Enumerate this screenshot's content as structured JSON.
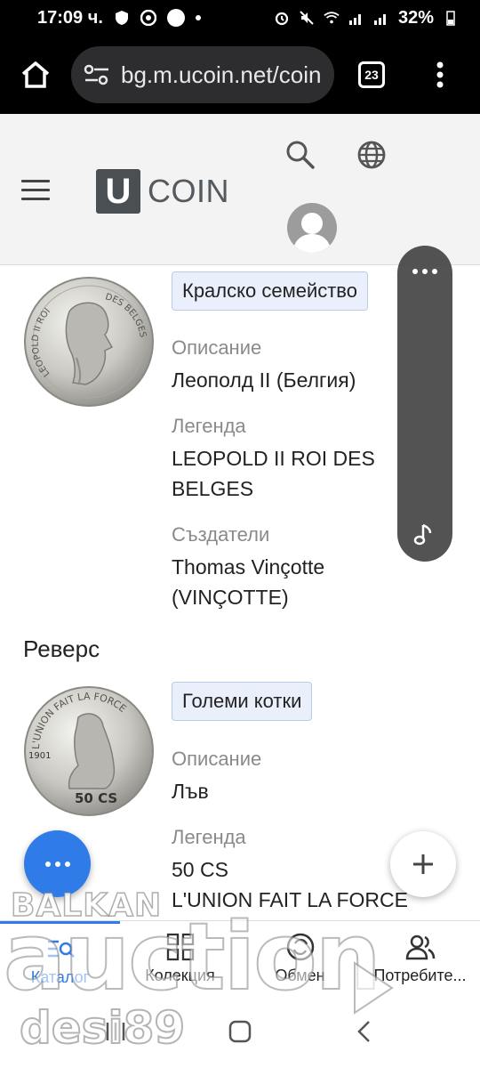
{
  "status_bar": {
    "time": "17:09 ч.",
    "battery": "32%"
  },
  "browser": {
    "url": "bg.m.ucoin.net/coin",
    "tab_count": "23"
  },
  "header": {
    "logo_letter": "U",
    "logo_text": "COIN"
  },
  "obverse": {
    "tag": "Кралско семейство",
    "description_label": "Описание",
    "description_value": "Леополд II (Белгия)",
    "legend_label": "Легенда",
    "legend_line1": "LEOPOLD II ROI DES",
    "legend_line2": "BELGES",
    "creators_label": "Създатели",
    "creators_line1": "Thomas Vinçotte",
    "creators_line2": "(VINÇOTTE)",
    "coin_legend_left": "LEOPOLD II ROI",
    "coin_legend_right": "DES BELGES"
  },
  "reverse": {
    "title": "Реверс",
    "tag": "Големи котки",
    "description_label": "Описание",
    "description_value": "Лъв",
    "legend_label": "Легенда",
    "legend_line1": "50 CS",
    "legend_line2": "L'UNION FAIT LA FORCE",
    "coin_legend_top": "L'UNION FAIT LA FORCE",
    "coin_year": "1901",
    "coin_value": "50 CS"
  },
  "bottom_nav": {
    "items": [
      {
        "label": "Каталог",
        "icon": "catalog-icon",
        "active": true
      },
      {
        "label": "Колекция",
        "icon": "collection-icon",
        "active": false
      },
      {
        "label": "Обмен",
        "icon": "exchange-icon",
        "active": false
      },
      {
        "label": "Потребите...",
        "icon": "users-icon",
        "active": false
      }
    ]
  },
  "watermark": {
    "brand": "BALKAN",
    "word": "auction",
    "user": "desi89"
  },
  "colors": {
    "accent": "#2f7be8",
    "tag_bg": "#eaf0fb",
    "header_bg": "#f3f3f3"
  }
}
